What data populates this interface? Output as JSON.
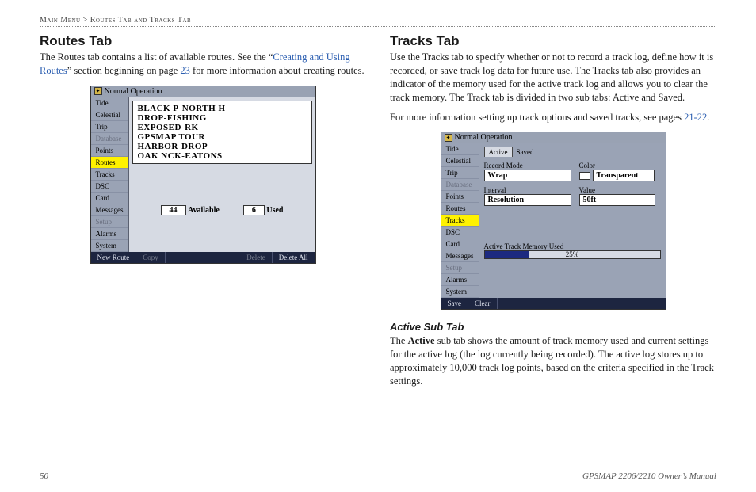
{
  "breadcrumb": {
    "main": "Main Menu",
    "sep": " > ",
    "sub": "Routes Tab and Tracks Tab"
  },
  "routes": {
    "heading": "Routes Tab",
    "para_a": "The Routes tab contains a list of available routes. See the “",
    "link": "Creating and Using Routes",
    "para_b": "” section beginning on page ",
    "pagelink": "23",
    "para_c": " for more information about creating routes."
  },
  "tracks": {
    "heading": "Tracks Tab",
    "para1": "Use the Tracks tab to specify whether or not to record a track log, define how it is recorded, or save track log data for future use. The Tracks tab also provides an indicator of the memory used for the active track log and allows you to clear the track memory. The Track tab is divided in two sub tabs: Active and Saved.",
    "para2a": "For more information setting up track options and saved tracks, see pages ",
    "para2link": "21-22",
    "para2b": "."
  },
  "active_sub": {
    "heading": "Active Sub Tab",
    "para_a": "The ",
    "bold": "Active",
    "para_b": " sub tab shows the amount of track memory used and current settings for the active log (the log currently being recorded). The active log stores up to approximately 10,000 track log points, based on the criteria specified in the Track settings."
  },
  "fig_shared": {
    "titlebar": "Normal Operation",
    "sidebar": [
      "Tide",
      "Celestial",
      "Trip",
      "Database",
      "Points",
      "Routes",
      "Tracks",
      "DSC",
      "Card",
      "Messages",
      "Setup",
      "Alarms",
      "System"
    ]
  },
  "fig_routes": {
    "active_tab": "Routes",
    "disabled_tabs": [
      "Database",
      "Setup"
    ],
    "list": [
      "BLACK P-NORTH H",
      "DROP-FISHING",
      "EXPOSED-RK",
      "GPSMAP TOUR",
      "HARBOR-DROP",
      "OAK NCK-EATONS"
    ],
    "available_count": "44",
    "available_label": "Available",
    "used_count": "6",
    "used_label": "Used",
    "buttons": {
      "new": "New Route",
      "copy": "Copy",
      "delete": "Delete",
      "delete_all": "Delete All"
    }
  },
  "fig_tracks": {
    "active_tab": "Tracks",
    "disabled_tabs": [
      "Database",
      "Setup"
    ],
    "subtabs": {
      "active": "Active",
      "saved": "Saved"
    },
    "labels": {
      "record_mode": "Record Mode",
      "color": "Color",
      "interval": "Interval",
      "value": "Value",
      "mem": "Active Track Memory Used"
    },
    "values": {
      "record_mode": "Wrap",
      "color": "Transparent",
      "interval": "Resolution",
      "value": "50ft",
      "pct": "25%"
    },
    "buttons": {
      "save": "Save",
      "clear": "Clear"
    }
  },
  "footer": {
    "page": "50",
    "manual": "GPSMAP 2206/2210 Owner’s Manual"
  }
}
